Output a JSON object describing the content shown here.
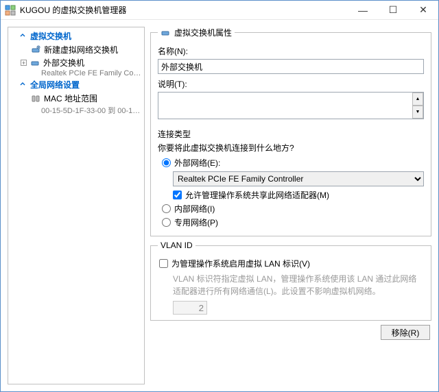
{
  "window": {
    "title": "KUGOU 的虚拟交换机管理器",
    "minimize": "—",
    "maximize": "☐",
    "close": "✕"
  },
  "sidebar": {
    "section_switch": "虚拟交换机",
    "items": [
      {
        "label": "新建虚拟网络交换机",
        "expander": ""
      },
      {
        "label": "外部交换机",
        "expander": "+",
        "sub": "Realtek PCIe FE Family Controller"
      }
    ],
    "section_global": "全局网络设置",
    "global_items": [
      {
        "label": "MAC 地址范围",
        "sub": "00-15-5D-1F-33-00 到 00-15-5D-1..."
      }
    ]
  },
  "props": {
    "legend": "虚拟交换机属性",
    "name_label": "名称(N):",
    "name_value": "外部交换机",
    "desc_label": "说明(T):",
    "desc_value": "",
    "conn": {
      "title": "连接类型",
      "hint": "你要将此虚拟交换机连接到什么地方?",
      "external": "外部网络(E):",
      "adapter": "Realtek PCIe FE Family Controller",
      "allow_mgmt": "允许管理操作系统共享此网络适配器(M)",
      "internal": "内部网络(I)",
      "private": "专用网络(P)"
    },
    "vlan": {
      "title": "VLAN ID",
      "enable": "为管理操作系统启用虚拟 LAN 标识(V)",
      "hint": "VLAN 标识符指定虚拟 LAN，管理操作系统使用该 LAN 通过此网络适配器进行所有网络通信(L)。此设置不影响虚拟机网络。",
      "value": "2"
    }
  },
  "buttons": {
    "remove": "移除(R)"
  }
}
